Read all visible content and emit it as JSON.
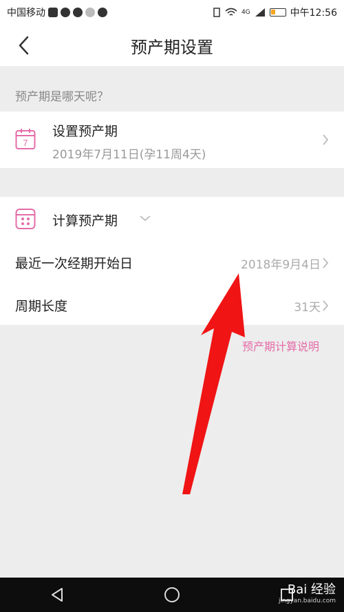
{
  "status_bar": {
    "carrier": "中国移动",
    "time": "中午12:56",
    "network": "4G"
  },
  "nav": {
    "title": "预产期设置",
    "back_icon": "chevron-left-icon"
  },
  "section": {
    "question": "预产期是哪天呢？"
  },
  "set_due": {
    "title": "设置预产期",
    "subtitle": "2019年7月11日(孕11周4天)",
    "icon": "calendar-icon"
  },
  "calc_due": {
    "title": "计算预产期",
    "icon": "calendar-grid-icon",
    "rows": [
      {
        "label": "最近一次经期开始日",
        "value": "2018年9月4日"
      },
      {
        "label": "周期长度",
        "value": "31天"
      }
    ]
  },
  "explain_link": "预产期计算说明",
  "watermark": {
    "brand": "Bai 经验",
    "site": "jingyan.baidu.com"
  },
  "colors": {
    "accent": "#e56ca8",
    "annotation_arrow": "#f01414",
    "background": "#ededed"
  }
}
